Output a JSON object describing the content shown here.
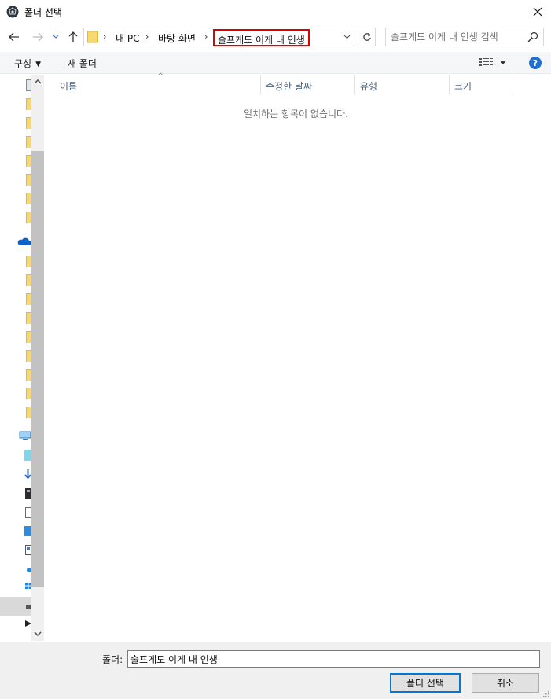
{
  "window": {
    "title": "폴더 선택"
  },
  "address": {
    "crumbs": [
      "내 PC",
      "바탕 화면"
    ],
    "current": "술프게도 이게 내 인생"
  },
  "search": {
    "placeholder": "술프게도 이게 내 인생 검색"
  },
  "commandbar": {
    "organize_label": "구성",
    "new_folder_label": "새 폴더",
    "help_label": "?"
  },
  "columns": [
    "이름",
    "수정한 날짜",
    "유형",
    "크기"
  ],
  "list": {
    "empty_message": "일치하는 항목이 없습니다."
  },
  "footer": {
    "folder_label": "폴더:",
    "folder_value": "술프게도 이게 내 인생",
    "select_label": "폴더 선택",
    "cancel_label": "취소"
  },
  "colors": {
    "accent": "#0078d7",
    "highlight_box": "#e00000",
    "help": "#1f6fd0"
  }
}
